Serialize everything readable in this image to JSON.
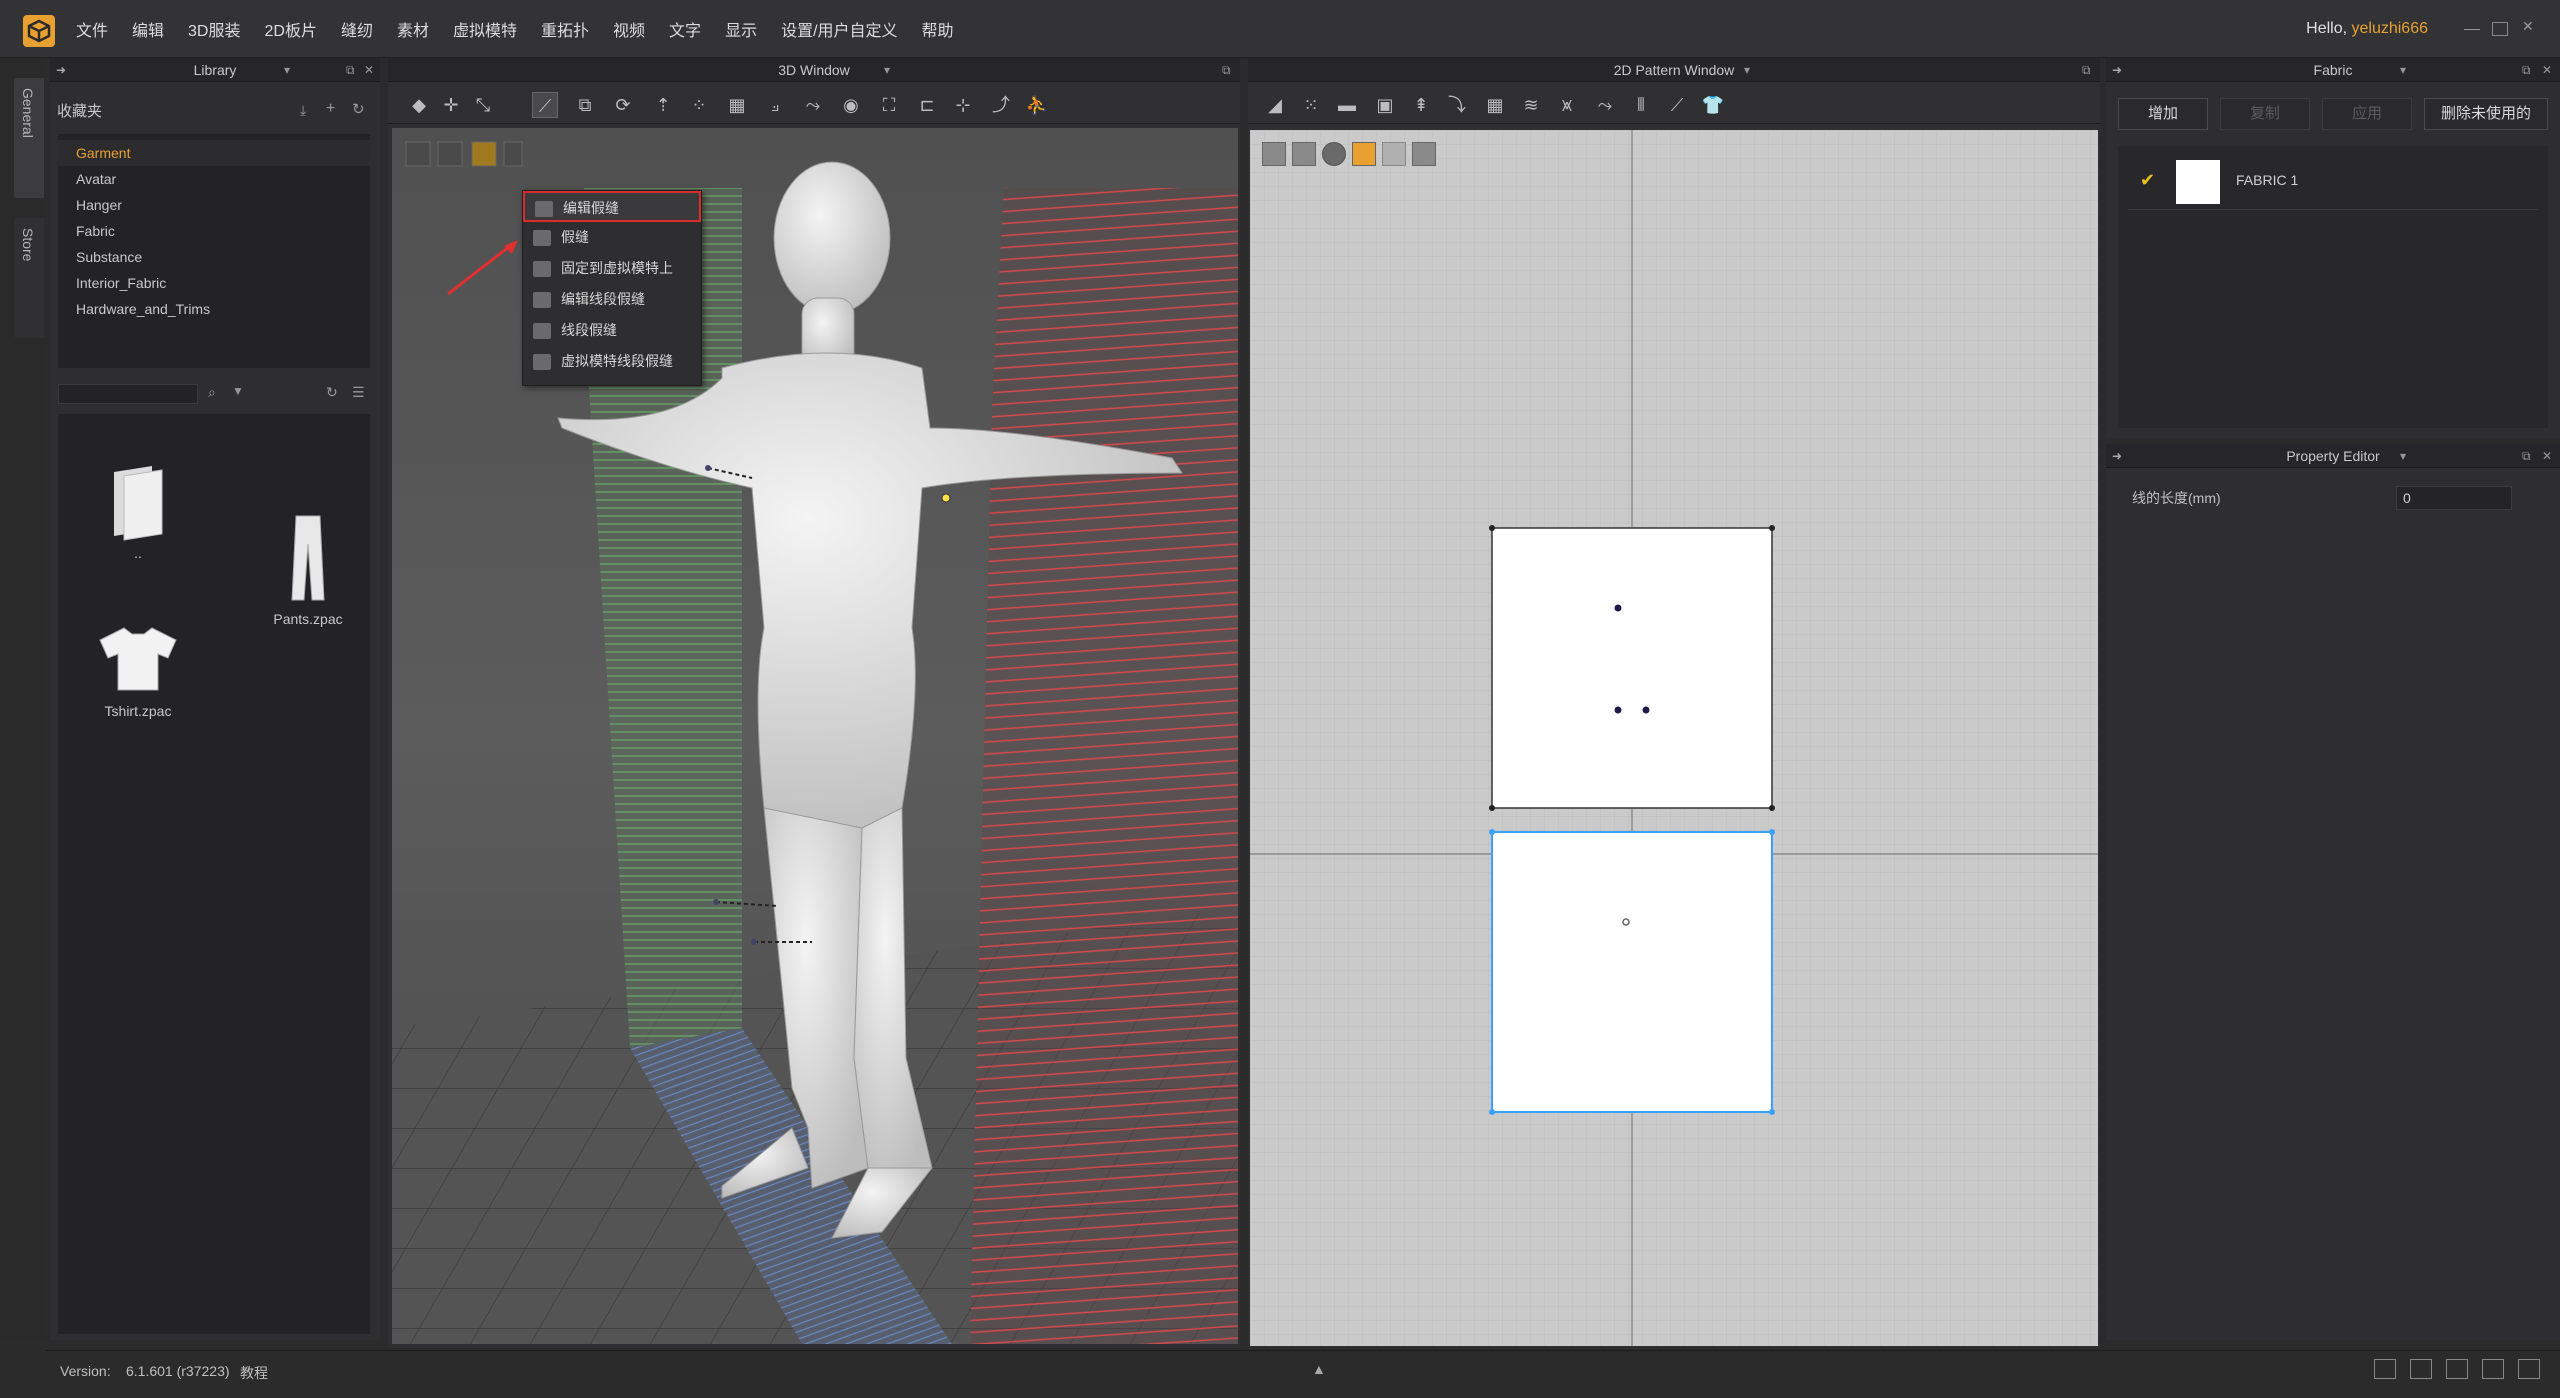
{
  "app": {
    "menu": [
      "文件",
      "编辑",
      "3D服装",
      "2D板片",
      "缝纫",
      "素材",
      "虚拟模特",
      "重拓扑",
      "视频",
      "文字",
      "显示",
      "设置/用户自定义",
      "帮助"
    ],
    "greeting": "Hello,",
    "username": "yeluzhi666"
  },
  "side_tabs": [
    "General",
    "Store"
  ],
  "library": {
    "title": "Library",
    "favorites_label": "收藏夹",
    "tree": [
      "Garment",
      "Avatar",
      "Hanger",
      "Fabric",
      "Substance",
      "Interior_Fabric",
      "Hardware_and_Trims"
    ],
    "selected": "Garment",
    "files": [
      {
        "name": "..",
        "icon": "folder-icon"
      },
      {
        "name": "Pants.zpac",
        "icon": "pants-icon"
      },
      {
        "name": "Tshirt.zpac",
        "icon": "tshirt-icon"
      }
    ]
  },
  "window3d": {
    "title": "3D Window",
    "dropdown": [
      "编辑假缝",
      "假缝",
      "固定到虚拟模特上",
      "编辑线段假缝",
      "线段假缝",
      "虚拟模特线段假缝"
    ],
    "highlighted_item": "编辑假缝"
  },
  "window2d": {
    "title": "2D Pattern Window"
  },
  "fabric_panel": {
    "title": "Fabric",
    "buttons": [
      {
        "label": "增加",
        "enabled": true
      },
      {
        "label": "复制",
        "enabled": false
      },
      {
        "label": "应用",
        "enabled": false
      },
      {
        "label": "删除未使用的",
        "enabled": true
      }
    ],
    "items": [
      {
        "name": "FABRIC 1",
        "checked": true
      }
    ]
  },
  "property_editor": {
    "title": "Property Editor",
    "field_label": "线的长度(mm)",
    "field_value": "0"
  },
  "status": {
    "version_label": "Version:",
    "version": "6.1.601 (r37223)",
    "tutorial": "教程"
  },
  "colors": {
    "accent": "#e8a030",
    "highlight_red": "#d92d2d",
    "selection_blue": "#3aa0ff"
  }
}
